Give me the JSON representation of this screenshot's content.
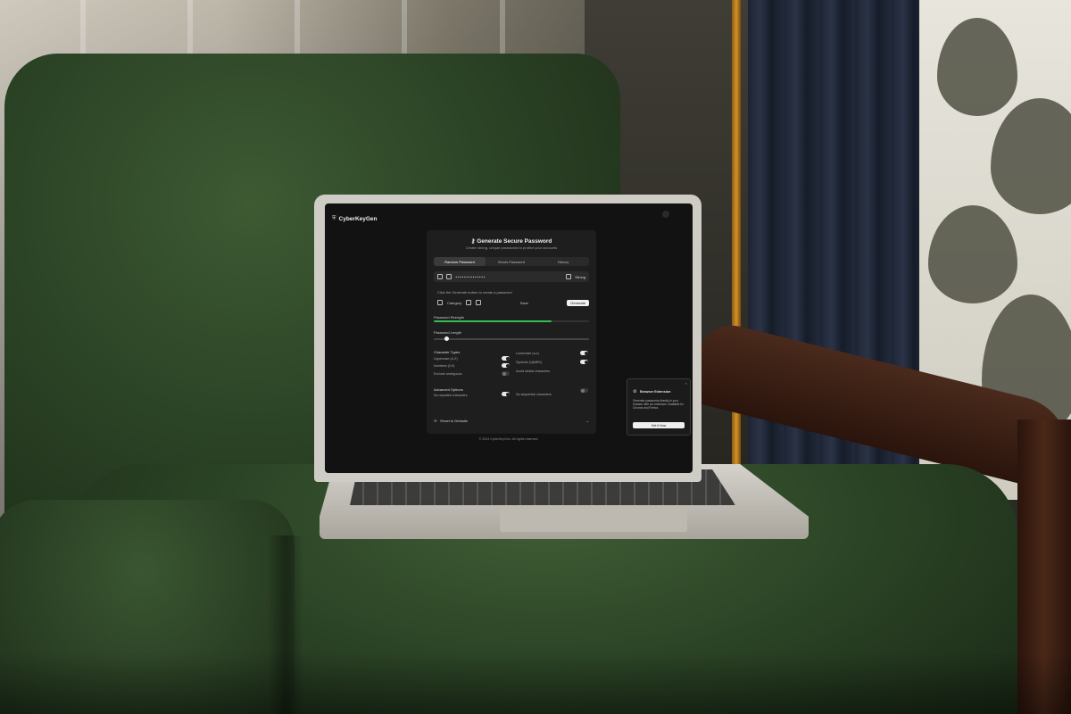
{
  "app": {
    "brand": "CyberKeyGen",
    "title": "Generate Secure Password",
    "subtitle": "Create strong, unique passwords to protect your accounts"
  },
  "tabs": [
    {
      "label": "Random Password",
      "active": true
    },
    {
      "label": "Words Password",
      "active": false
    },
    {
      "label": "History",
      "active": false
    }
  ],
  "password": {
    "value": "••••••••••••••",
    "strength_label": "Strong"
  },
  "actions": {
    "hint": "Click the Generate button to create a password",
    "category_label": "Category",
    "save_label": "Save",
    "generate_label": "Generate"
  },
  "meter": {
    "label": "Password Strength",
    "value_label": "",
    "fill_fraction": 0.76,
    "color": "#2fbf53"
  },
  "length": {
    "label": "Password Length",
    "value_fraction": 0.07
  },
  "character_types": {
    "heading": "Character Types",
    "options": [
      {
        "label": "Uppercase (A-Z)",
        "on": true
      },
      {
        "label": "Lowercase (a-z)",
        "on": true
      },
      {
        "label": "Numbers (0-9)",
        "on": true
      },
      {
        "label": "Symbols (!@#$%)",
        "on": true
      },
      {
        "label": "Exclude ambiguous",
        "on": false
      },
      {
        "label": "Avoid similar characters",
        "on": false
      }
    ]
  },
  "advanced": {
    "heading": "Advanced Options",
    "options": [
      {
        "label": "No repeated characters",
        "on": true
      },
      {
        "label": "No sequential characters",
        "on": false
      }
    ]
  },
  "reset_label": "Reset to Defaults",
  "footer": "© 2024 CyberKeyGen. All rights reserved.",
  "toast": {
    "title": "Browser Extension",
    "body": "Generate passwords directly in your browser with our extension. Available for Chrome and Firefox.",
    "button_label": "Get It Now",
    "close": "×"
  }
}
